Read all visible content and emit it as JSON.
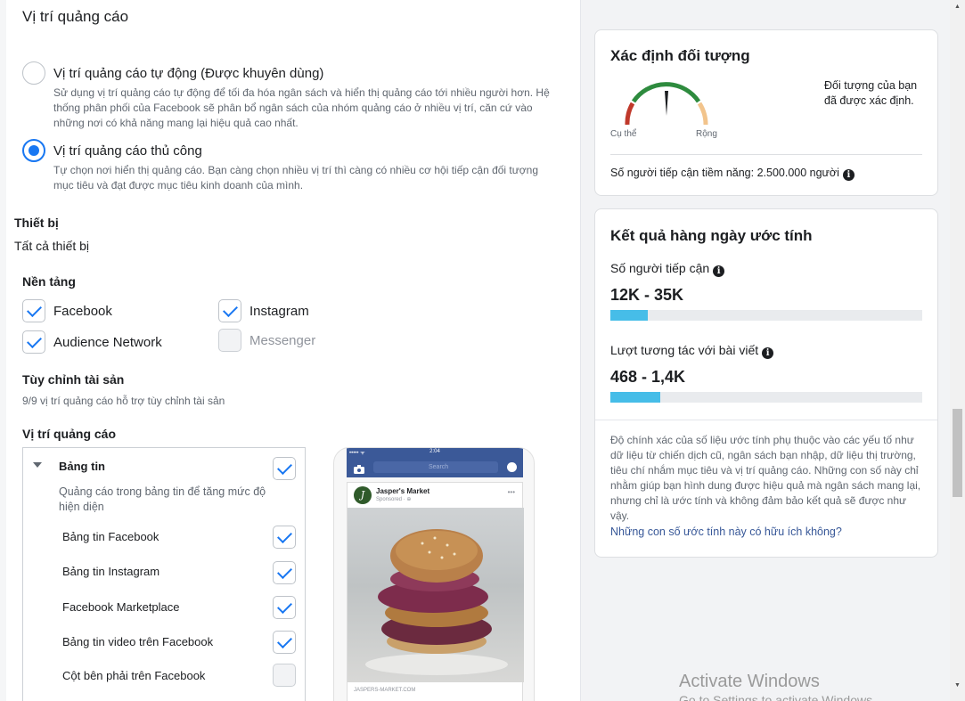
{
  "placement": {
    "section_title": "Vị trí quảng cáo",
    "auto_title": "Vị trí quảng cáo tự động (Được khuyên dùng)",
    "auto_desc": "Sử dụng vị trí quảng cáo tự động để tối đa hóa ngân sách và hiển thị quảng cáo tới nhiều người hơn. Hệ thống phân phối của Facebook sẽ phân bổ ngân sách của nhóm quảng cáo ở nhiều vị trí, căn cứ vào những nơi có khả năng mang lại hiệu quả cao nhất.",
    "manual_title": "Vị trí quảng cáo thủ công",
    "manual_desc": "Tự chọn nơi hiển thị quảng cáo. Bạn càng chọn nhiều vị trí thì càng có nhiều cơ hội tiếp cận đối tượng mục tiêu và đạt được mục tiêu kinh doanh của mình.",
    "selected": "manual"
  },
  "devices": {
    "label": "Thiết bị",
    "value": "Tất cả thiết bị"
  },
  "platforms": {
    "label": "Nền tảng",
    "items": [
      {
        "name": "Facebook",
        "checked": true,
        "enabled": true
      },
      {
        "name": "Instagram",
        "checked": true,
        "enabled": true
      },
      {
        "name": "Audience Network",
        "checked": true,
        "enabled": true
      },
      {
        "name": "Messenger",
        "checked": false,
        "enabled": false
      }
    ]
  },
  "asset_custom": {
    "label": "Tùy chỉnh tài sản",
    "desc": "9/9 vị trí quảng cáo hỗ trợ tùy chỉnh tài sản"
  },
  "placements_list": {
    "label": "Vị trí quảng cáo",
    "group_title": "Bảng tin",
    "group_desc": "Quảng cáo trong bảng tin để tăng mức độ hiện diện",
    "items": [
      {
        "name": "Bảng tin Facebook",
        "checked": true
      },
      {
        "name": "Bảng tin Instagram",
        "checked": true
      },
      {
        "name": "Facebook Marketplace",
        "checked": true
      },
      {
        "name": "Bảng tin video trên Facebook",
        "checked": true
      },
      {
        "name": "Cột bên phải trên Facebook",
        "checked": false
      }
    ]
  },
  "preview": {
    "time": "2:04",
    "carrier": "••••• ᯤ",
    "search_placeholder": "Search",
    "brand_initial": "J",
    "brand_name": "Jasper's Market",
    "brand_sub": "Sponsored · ⊕",
    "more": "•••",
    "footer": "JASPERS-MARKET.COM"
  },
  "audience": {
    "title": "Xác định đối tượng",
    "gauge_left": "Cụ thể",
    "gauge_right": "Rộng",
    "status": "Đối tượng của bạn đã được xác định.",
    "potential_reach": "Số người tiếp cận tiềm năng: 2.500.000 người"
  },
  "estimates": {
    "title": "Kết quả hàng ngày ước tính",
    "reach_label": "Số người tiếp cận",
    "reach_value": "12K - 35K",
    "reach_fill": 0.12,
    "engagement_label": "Lượt tương tác với bài viết",
    "engagement_value": "468 - 1,4K",
    "engagement_fill": 0.16,
    "disclaimer": "Độ chính xác của số liệu ước tính phụ thuộc vào các yếu tố như dữ liệu từ chiến dịch cũ, ngân sách bạn nhập, dữ liệu thị trường, tiêu chí nhắm mục tiêu và vị trí quảng cáo. Những con số này chỉ nhằm giúp bạn hình dung được hiệu quả mà ngân sách mang lại, nhưng chỉ là ước tính và không đảm bảo kết quả sẽ được như vậy.",
    "feedback_link": "Những con số ước tính này có hữu ích không?"
  },
  "watermark": {
    "line1": "Activate Windows",
    "line2": "Go to Settings to activate Windows."
  },
  "colors": {
    "accent": "#1877f2",
    "bar": "#46bde8",
    "link": "#385898"
  }
}
